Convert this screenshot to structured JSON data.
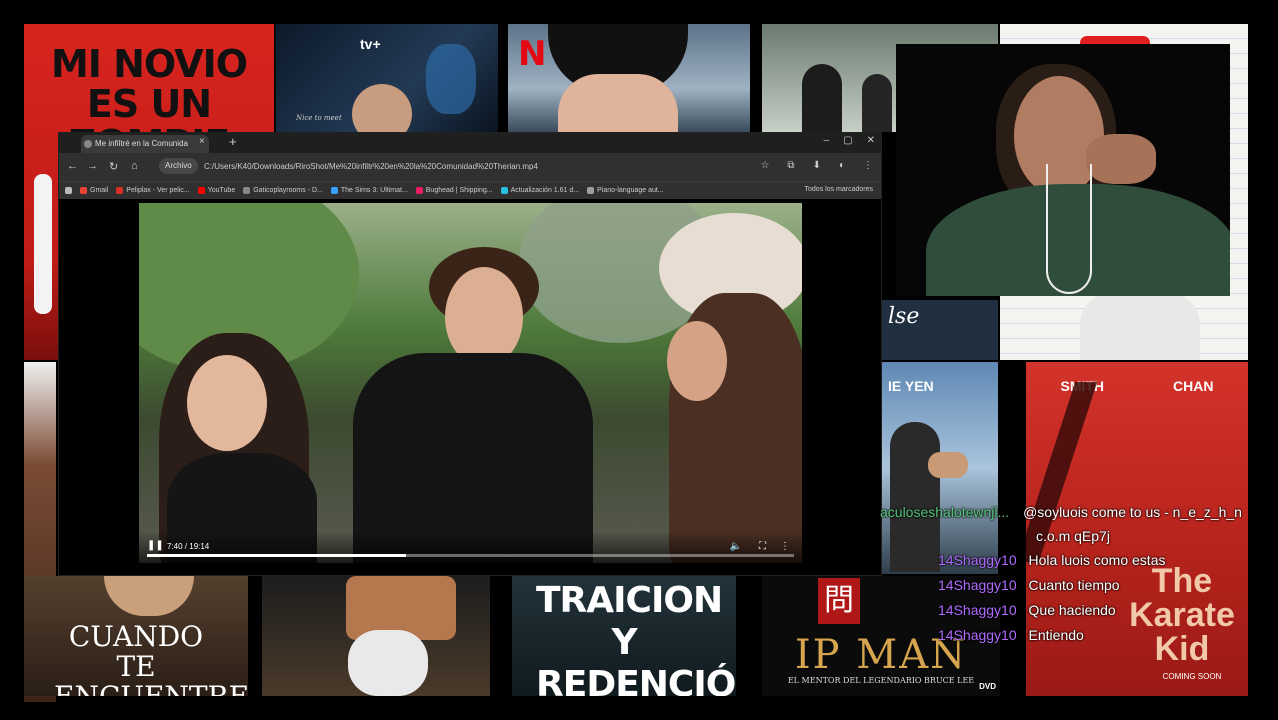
{
  "posters": {
    "zombie_title": "MI NOVIO ES UN ZOMBIE",
    "appletv_logo": "tv+",
    "appletv_tagline": "Nice to meet",
    "netflix_logo": "N",
    "cuando_title": "CUANDO TE ENCUENTRE",
    "traicion_title": "TRAICION Y REDENCIÓN",
    "ipman_title": "IP MAN",
    "ipman_subtitle": "EL MENTOR DEL LEGENDARIO BRUCE LEE",
    "ipman_dvd": "DVD",
    "ipman_seal": "問",
    "donnie_yen": "IE YEN",
    "karate_actor1": "SMITH",
    "karate_actor2": "CHAN",
    "karate_title": "The Karate Kid",
    "karate_coming": "COMING SOON",
    "ilse_fragment": "lse"
  },
  "browser": {
    "tab_title": "Me infiltré en la Comunida",
    "tab_close": "×",
    "new_tab": "+",
    "window_controls": [
      "–",
      "▢",
      "✕"
    ],
    "nav": [
      "←",
      "→",
      "↻",
      "⌂"
    ],
    "origin_label": "Archivo",
    "url": "C:/Users/K40/Downloads/RiroShot/Me%20infiltr%20en%20la%20Comunidad%20Therian.mp4",
    "toolbar_icons": [
      "☆",
      "⧉",
      "⬇",
      "◐",
      "⋮"
    ],
    "bookmarks": [
      {
        "label": "Gmail",
        "color": "#ea4335"
      },
      {
        "label": "Peliplax - Ver pelic...",
        "color": "#d93025"
      },
      {
        "label": "YouTube",
        "color": "#ff0000"
      },
      {
        "label": "Gaticoplayrooms - D...",
        "color": "#888888"
      },
      {
        "label": "The Sims 3: Ultimat...",
        "color": "#3aa0ff"
      },
      {
        "label": "Bughead | Shipping...",
        "color": "#e91e63"
      },
      {
        "label": "Actualización 1.61 d...",
        "color": "#24c1e0"
      },
      {
        "label": "Piano-language aut...",
        "color": "#9e9e9e"
      }
    ],
    "bookmarks_all": "Todos los marcadores"
  },
  "video": {
    "time": "7:40 / 19:14",
    "progress": 0.4,
    "play_icon": "❚❚",
    "volume_icon": "🔈",
    "fullscreen_icon": "⛶",
    "more_icon": "⋮"
  },
  "chat": [
    {
      "user": "aculoseshalotewnjl...",
      "text": "@soyluois come to us - n_e_z_h_n"
    },
    {
      "user": "",
      "text": "c.o.m qEp7j"
    },
    {
      "user": "14Shaggy10",
      "text": "Hola luois como estas"
    },
    {
      "user": "14Shaggy10",
      "text": "Cuanto tiempo"
    },
    {
      "user": "14Shaggy10",
      "text": "Que haciendo"
    },
    {
      "user": "14Shaggy10",
      "text": "Entiendo"
    }
  ]
}
